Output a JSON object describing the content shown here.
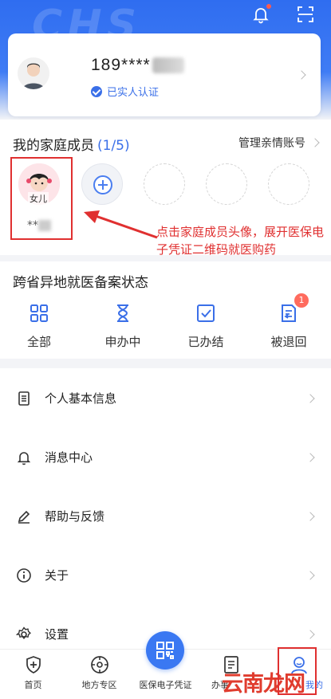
{
  "header": {
    "logo_text": "CHS",
    "icons": [
      "bell-icon",
      "scan-icon"
    ],
    "accent_color": "#3a6fe8"
  },
  "profile": {
    "phone": "189****",
    "verified_label": "已实人认证",
    "icons": [
      "avatar",
      "verified-icon",
      "chevron-right-icon"
    ]
  },
  "family": {
    "title": "我的家庭成员",
    "count": "(1/5)",
    "manage_label": "管理亲情账号",
    "members": [
      {
        "avatar_label": "女儿",
        "name": "**"
      }
    ],
    "annotation": "点击家庭成员头像，展开医保电子凭证二维码就医购药",
    "annotation_color": "#e03030"
  },
  "filing": {
    "title": "跨省异地就医备案状态",
    "items": [
      {
        "label": "全部",
        "icon": "grid-icon"
      },
      {
        "label": "申办中",
        "icon": "hourglass-icon"
      },
      {
        "label": "已办结",
        "icon": "check-box-icon"
      },
      {
        "label": "被退回",
        "icon": "return-doc-icon",
        "badge": "1"
      }
    ]
  },
  "menu": {
    "items": [
      {
        "label": "个人基本信息",
        "icon": "document-icon"
      },
      {
        "label": "消息中心",
        "icon": "bell-icon"
      },
      {
        "label": "帮助与反馈",
        "icon": "pen-icon"
      },
      {
        "label": "关于",
        "icon": "info-icon"
      },
      {
        "label": "设置",
        "icon": "gear-icon"
      }
    ]
  },
  "tabbar": {
    "tabs": [
      {
        "label": "首页",
        "icon": "shield-plus-icon"
      },
      {
        "label": "地方专区",
        "icon": "compass-icon"
      },
      {
        "label": "医保电子凭证",
        "icon": "qr-code-icon"
      },
      {
        "label": "办事",
        "icon": "clipboard-icon"
      },
      {
        "label": "我的",
        "icon": "person-icon"
      }
    ]
  },
  "watermark": "云南龙网"
}
